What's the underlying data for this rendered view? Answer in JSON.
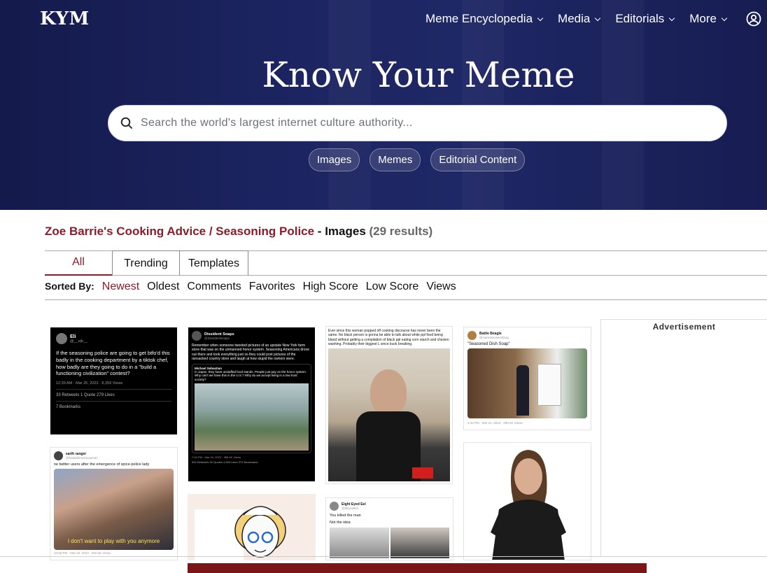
{
  "header": {
    "logo": "KYM",
    "nav": [
      "Meme Encyclopedia",
      "Media",
      "Editorials",
      "More"
    ],
    "title": "Know Your Meme",
    "search_placeholder": "Search the world's largest internet culture authority...",
    "pills": [
      "Images",
      "Memes",
      "Editorial Content"
    ]
  },
  "page": {
    "meme_link": "Zoe Barrie's Cooking Advice / Seasoning Police",
    "separator": " - ",
    "section": "Images",
    "count": "(29 results)"
  },
  "tabs": [
    "All",
    "Trending",
    "Templates"
  ],
  "sort": {
    "label": "Sorted By:",
    "options": [
      "Newest",
      "Oldest",
      "Comments",
      "Favorites",
      "High Score",
      "Low Score",
      "Views"
    ]
  },
  "cards": {
    "c1": {
      "name": "Eli",
      "handle": "@__ejb__",
      "text": "If the seasoning police are going to get btfo'd this badly in the cooking department by a tiktok chef, how badly are they going to do in a \"build a functioning civilization\" contest?",
      "time": "12:39 AM · Mar 25, 2023 · 8,359 Views",
      "stats": "33 Retweets   1 Quote   279 Likes",
      "bookmarks": "7 Bookmarks"
    },
    "c2": {
      "name": "Dissident Soaps",
      "handle": "@DissidentSoaps",
      "text": "Remember when someone tweeted pictures of an upstate New York farm store that was on the unmanned honor system. Seasoning Americans drove out there and took everything just so they could post pictures of the ransacked country store and laugh at how stupid the owners were.",
      "quote_name": "Michael Sebastian",
      "quote_text": "In Japan, they have unstaffed food stands. People just pay on the honor system. Why can't we have this in the U.S.? Why do we accept living in a low trust society?",
      "time": "7:04 PM · Mar 24, 2023 · 386.4K Views",
      "stats": "594 Retweets   30 Quotes   4,803 Likes   374 Bookmarks"
    },
    "c3": {
      "text": "Ever since this woman popped off cooking discourse has never been the same. No black person is gonna be able to talk about white ppl food being bland without getting a compilation of black ppl eating corn starch and chicken washing. Probably their biggest L since buck breaking."
    },
    "c4": {
      "name": "Battle Beagle",
      "handle": "@HarmlessNerdDog",
      "text": "\"Seasoned Dish Soap\"",
      "time": "2:43 PM · Mar 21, 2023 · 290.4K Views"
    },
    "c5": {
      "name": "earth ranger",
      "handle": "@balaidhinsmeowman",
      "text": "ne twitter users after the emergence of spice-police lady",
      "caption": "I don't want to play with you anymore",
      "time": "10:56 PM · Mar 20, 2023 · 202.6K Views"
    },
    "c7": {
      "name": "Eight Eyed Eel",
      "handle": "@8EyedEel",
      "line1": "You killed the man",
      "line2": "Not the idea"
    }
  },
  "ad": {
    "label": "Advertisement"
  },
  "colors": {
    "hero_bg": "#1c2460",
    "accent": "#8a1d2a",
    "ad_bar": "#7b1616"
  }
}
